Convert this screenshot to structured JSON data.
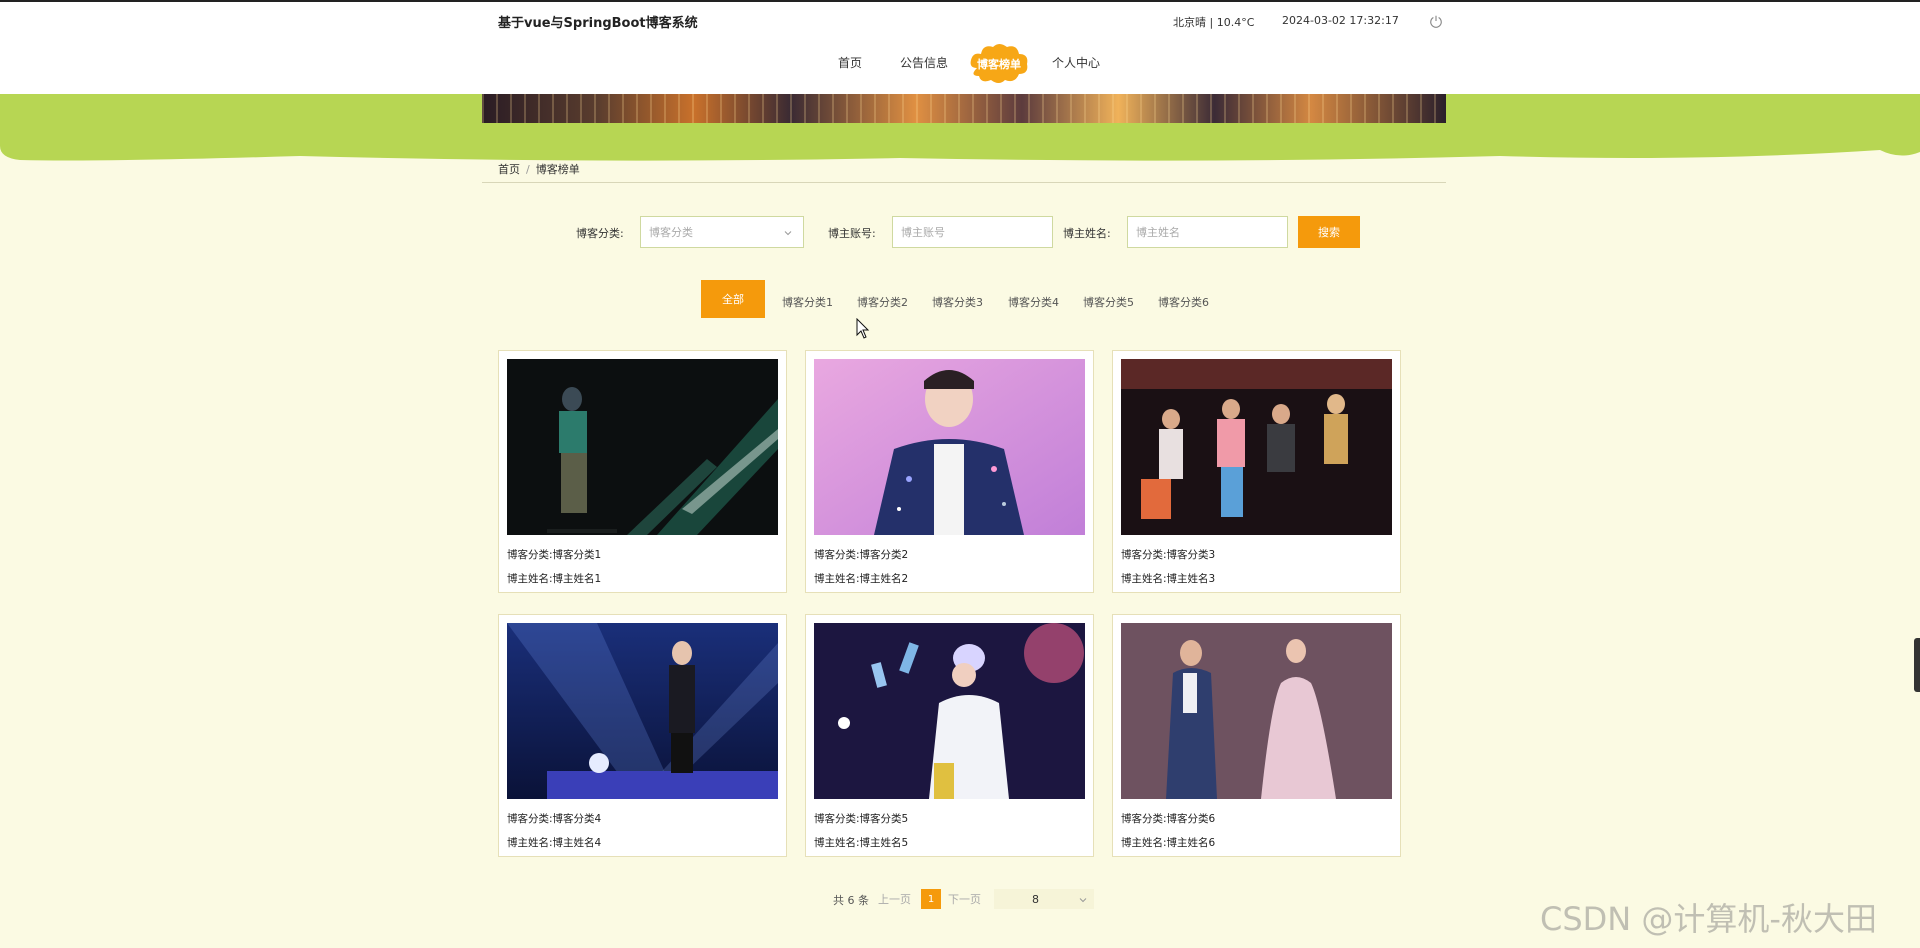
{
  "header": {
    "site_title": "基于vue与SpringBoot博客系统",
    "weather": "北京晴 | 10.4°C",
    "datetime": "2024-03-02   17:32:17",
    "power_icon": "power-icon"
  },
  "nav": {
    "items": [
      {
        "label": "首页"
      },
      {
        "label": "公告信息"
      },
      {
        "label": "博客榜单"
      },
      {
        "label": "个人中心"
      }
    ],
    "active_index": 2
  },
  "breadcrumb": {
    "home": "首页",
    "separator": "/",
    "current": "博客榜单"
  },
  "filters": {
    "category_label": "博客分类:",
    "category_placeholder": "博客分类",
    "account_label": "博主账号:",
    "account_placeholder": "博主账号",
    "name_label": "博主姓名:",
    "name_placeholder": "博主姓名",
    "search_label": "搜索"
  },
  "tabs": {
    "items": [
      "全部",
      "博客分类1",
      "博客分类2",
      "博客分类3",
      "博客分类4",
      "博客分类5",
      "博客分类6"
    ],
    "active_index": 0
  },
  "cards": [
    {
      "category_label": "博客分类:",
      "category": "博客分类1",
      "name_label": "博主姓名:",
      "name": "博主姓名1"
    },
    {
      "category_label": "博客分类:",
      "category": "博客分类2",
      "name_label": "博主姓名:",
      "name": "博主姓名2"
    },
    {
      "category_label": "博客分类:",
      "category": "博客分类3",
      "name_label": "博主姓名:",
      "name": "博主姓名3"
    },
    {
      "category_label": "博客分类:",
      "category": "博客分类4",
      "name_label": "博主姓名:",
      "name": "博主姓名4"
    },
    {
      "category_label": "博客分类:",
      "category": "博客分类5",
      "name_label": "博主姓名:",
      "name": "博主姓名5"
    },
    {
      "category_label": "博客分类:",
      "category": "博客分类6",
      "name_label": "博主姓名:",
      "name": "博主姓名6"
    }
  ],
  "pagination": {
    "total": "共 6 条",
    "prev": "上一页",
    "current": "1",
    "next": "下一页",
    "page_size": "8"
  },
  "watermark": "CSDN @计算机-秋大田",
  "colors": {
    "accent": "#f59a0c",
    "green_band": "#b7d653",
    "page_bg": "#fbfae3"
  }
}
